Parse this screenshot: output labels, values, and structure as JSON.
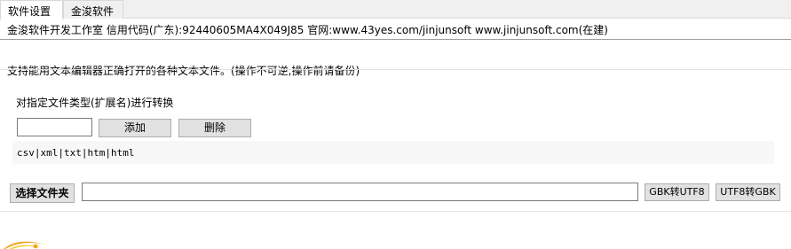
{
  "tabs": [
    {
      "label": "软件设置",
      "active": true
    },
    {
      "label": "金浚软件",
      "active": false
    }
  ],
  "info": {
    "text": "金浚软件开发工作室 信用代码(广东):92440605MA4X049J85 官网:www.43yes.com/jinjunsoft  www.jinjunsoft.com(在建)"
  },
  "main": {
    "description": "支持能用文本编辑器正确打开的各种文本文件。(操作不可逆,操作前请备份)",
    "section_label": "对指定文件类型(扩展名)进行转换",
    "ext_input": {
      "value": "",
      "placeholder": ""
    },
    "add_label": "添加",
    "delete_label": "删除",
    "extensions_text": "csv|xml|txt|htm|html",
    "folder_button_label": "选择文件夹",
    "path_input": {
      "value": "",
      "placeholder": ""
    },
    "gbk_to_utf8_label": "GBK转UTF8",
    "utf8_to_gbk_label": "UTF8转GBK"
  },
  "colors": {
    "logo_orange": "#f5a623",
    "logo_yellow": "#f8d34a",
    "button_bg": "#e1e1e1"
  }
}
